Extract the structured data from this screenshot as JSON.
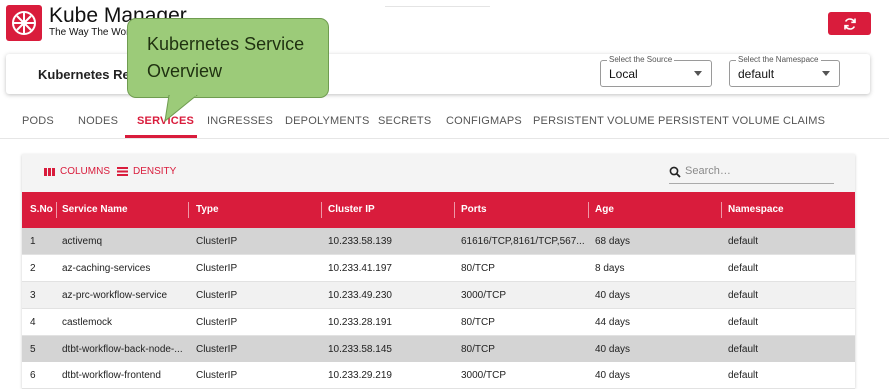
{
  "app": {
    "title": "Kube Manager",
    "subtitle": "The Way The World I",
    "accent": "#d91c3c"
  },
  "card": {
    "title": "Kubernetes Res",
    "source": {
      "label": "Select the Source",
      "value": "Local"
    },
    "namespace": {
      "label": "Select the Namespace",
      "value": "default"
    }
  },
  "callout": {
    "line1": "Kubernetes Service",
    "line2": "Overview",
    "color": "#9ccb79"
  },
  "tabs": [
    {
      "label": "PODS"
    },
    {
      "label": "NODES"
    },
    {
      "label": "SERVICES"
    },
    {
      "label": "INGRESSES"
    },
    {
      "label": "DEPOLYMENTS"
    },
    {
      "label": "SECRETS"
    },
    {
      "label": "CONFIGMAPS"
    },
    {
      "label": "PERSISTENT VOLUME"
    },
    {
      "label": "PERSISTENT VOLUME CLAIMS"
    }
  ],
  "toolbar": {
    "columns": "COLUMNS",
    "density": "DENSITY",
    "search_placeholder": "Search…"
  },
  "columns": [
    "S.No",
    "Service Name",
    "Type",
    "Cluster IP",
    "Ports",
    "Age",
    "Namespace"
  ],
  "rows": [
    [
      "1",
      "activemq",
      "ClusterIP",
      "10.233.58.139",
      "61616/TCP,8161/TCP,567...",
      "68 days",
      "default"
    ],
    [
      "2",
      "az-caching-services",
      "ClusterIP",
      "10.233.41.197",
      "80/TCP",
      "8 days",
      "default"
    ],
    [
      "3",
      "az-prc-workflow-service",
      "ClusterIP",
      "10.233.49.230",
      "3000/TCP",
      "40 days",
      "default"
    ],
    [
      "4",
      "castlemock",
      "ClusterIP",
      "10.233.28.191",
      "80/TCP",
      "44 days",
      "default"
    ],
    [
      "5",
      "dtbt-workflow-back-node-...",
      "ClusterIP",
      "10.233.58.145",
      "80/TCP",
      "40 days",
      "default"
    ],
    [
      "6",
      "dtbt-workflow-frontend",
      "ClusterIP",
      "10.233.29.219",
      "3000/TCP",
      "40 days",
      "default"
    ]
  ],
  "icons": {
    "logo": "kubernetes-helm-icon",
    "refresh": "refresh-icon",
    "columns": "columns-icon",
    "density": "density-icon",
    "search": "search-icon",
    "dropdown": "caret-down-icon"
  }
}
